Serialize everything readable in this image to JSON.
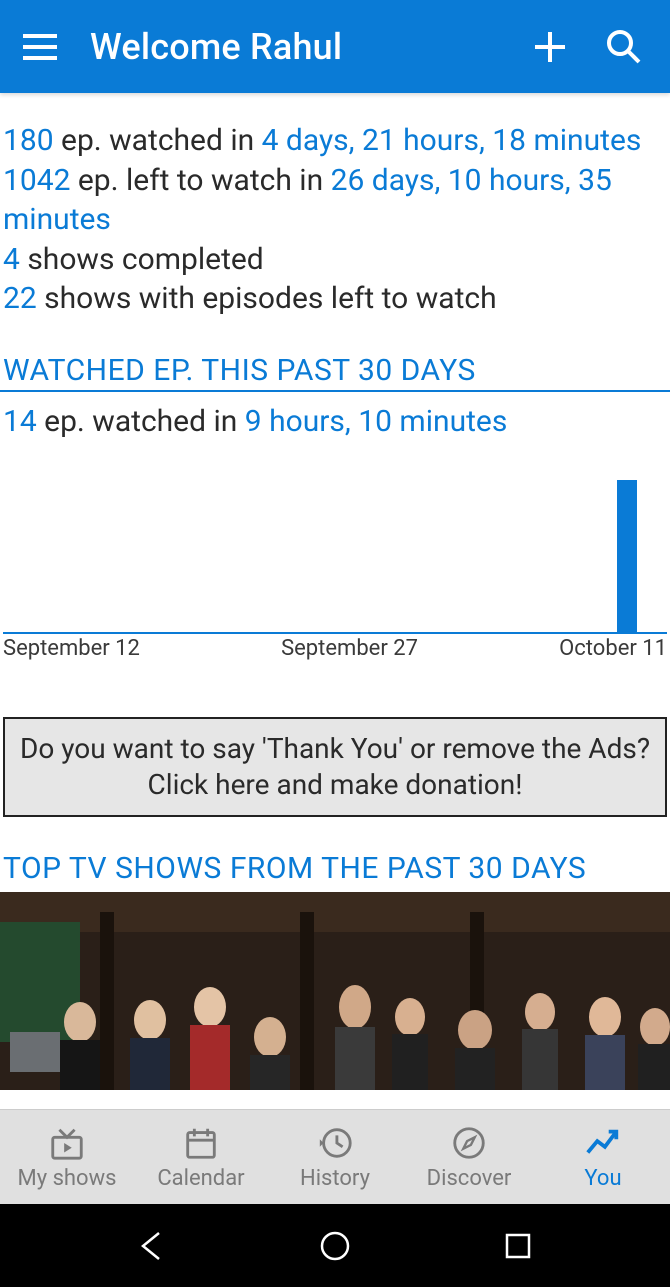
{
  "header": {
    "title": "Welcome Rahul"
  },
  "stats": {
    "watched_count": "180",
    "watched_label_a": " ep. watched in ",
    "watched_time": "4 days, 21 hours, 18 minutes",
    "left_count": "1042",
    "left_label_a": " ep. left to watch in ",
    "left_time": "26 days, 10 hours, 35 minutes",
    "completed_count": "4",
    "completed_label": " shows completed",
    "pending_count": "22",
    "pending_label": " shows with episodes left to watch"
  },
  "section30": {
    "title": "WATCHED EP. THIS PAST 30 DAYS",
    "watched_count": "14",
    "watched_label": " ep. watched in ",
    "watched_time": "9 hours, 10 minutes"
  },
  "chart_data": {
    "type": "bar",
    "categories": [
      "September 12",
      "September 27",
      "October 11"
    ],
    "values_by_day": {
      "October 11": 14
    },
    "title": "",
    "xlabel": "",
    "ylabel": "",
    "ylim": [
      0,
      14
    ],
    "series": [
      {
        "name": "episodes watched",
        "values": [
          0,
          0,
          0,
          0,
          0,
          0,
          0,
          0,
          0,
          0,
          0,
          0,
          0,
          0,
          0,
          0,
          0,
          0,
          0,
          0,
          0,
          0,
          0,
          0,
          0,
          0,
          0,
          0,
          0,
          14
        ]
      }
    ]
  },
  "chart_labels": {
    "l0": "September 12",
    "l1": "September 27",
    "l2": "October 11"
  },
  "donation": {
    "text": "Do you want to say 'Thank You' or remove the Ads? Click here and make donation!"
  },
  "top_shows": {
    "title": "TOP TV SHOWS FROM THE PAST 30 DAYS"
  },
  "nav": {
    "my_shows": "My shows",
    "calendar": "Calendar",
    "history": "History",
    "discover": "Discover",
    "you": "You"
  }
}
